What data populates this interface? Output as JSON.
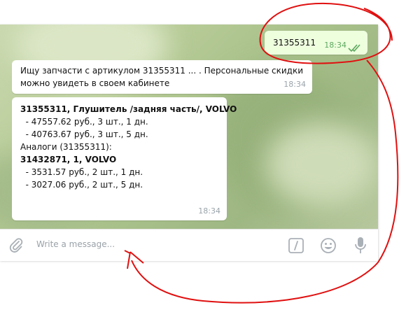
{
  "messages": [
    {
      "direction": "out",
      "text": "31355311",
      "time": "18:34"
    },
    {
      "direction": "in",
      "lines": [
        "Ищу запчасти с артикулом 31355311 ... . Персональные скидки",
        "можно увидеть в своем кабинете"
      ],
      "time": "18:34"
    },
    {
      "direction": "in",
      "lines": [
        "31355311, Глушитель /задняя часть/, VOLVO",
        "  - 47557.62 руб., 3 шт., 1 дн.",
        "  - 40763.67 руб., 3 шт., 5 дн.",
        "",
        "Аналоги (31355311):",
        "",
        "31432871, 1, VOLVO",
        "  - 3531.57 руб., 2 шт., 1 дн.",
        "  - 3027.06 руб., 2 шт., 5 дн."
      ],
      "time": "18:34"
    }
  ],
  "input": {
    "placeholder": "Write a message..."
  },
  "icons": {
    "attach": "paperclip-icon",
    "commands": "slash-command-icon",
    "emoji": "smiley-icon",
    "voice": "microphone-icon"
  },
  "colors": {
    "outgoing_bubble": "#eeffde",
    "incoming_bubble": "#ffffff",
    "annotation": "#e01010"
  }
}
